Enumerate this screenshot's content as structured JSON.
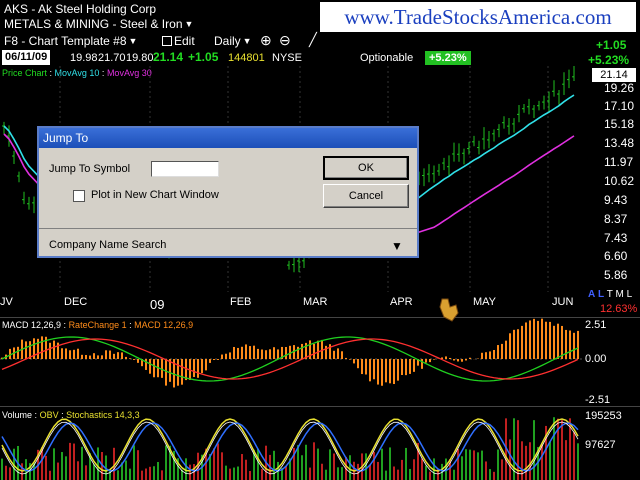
{
  "header": {
    "symbol_line": "AKS - Ak Steel Holding Corp",
    "sector": "METALS & MINING - Steel & Iron",
    "template": "F8 - Chart Template #8",
    "edit": "Edit",
    "period": "Daily"
  },
  "watermark": "www.TradeStocksAmerica.com",
  "quote": {
    "date": "06/11/09",
    "open": "19.98",
    "high": "21.70",
    "low": "19.80",
    "last": "21.14",
    "change": "+1.05",
    "volume": "144801",
    "exchange": "NYSE",
    "optionable": "Optionable",
    "pct": "+5.23%",
    "right_change": "+1.05",
    "right_pct": "+5.23%",
    "last_box": "21.14"
  },
  "price_panel": {
    "label_price": "Price Chart",
    "label_ma10": "MovAvg 10",
    "label_ma30": "MovAvg 30",
    "y_labels": [
      "19.26",
      "17.10",
      "15.18",
      "13.48",
      "11.97",
      "10.62",
      "9.43",
      "8.37",
      "7.43",
      "6.60",
      "5.86"
    ],
    "x_labels": [
      "JV",
      "DEC",
      "09",
      "FEB",
      "MAR",
      "APR",
      "MAY",
      "JUN"
    ],
    "period_buttons": [
      "A",
      "L",
      "T",
      "M",
      "L"
    ],
    "bottom_pct": "12.63%"
  },
  "macd_panel": {
    "label_macd": "MACD 12,26,9",
    "label_rate": "RateChange 1",
    "label_macd2": "MACD 12,26,9",
    "y_labels": [
      "2.51",
      "0.00",
      "-2.51"
    ]
  },
  "volume_panel": {
    "label_volume": "Volume",
    "label_obv": "OBV",
    "label_stoch": "Stochastics 14,3,3",
    "y_labels": [
      "195253",
      "97627"
    ]
  },
  "dialog": {
    "title": "Jump To",
    "symbol_label": "Jump To Symbol",
    "symbol_value": "",
    "plot_new_label": "Plot in New Chart Window",
    "ok": "OK",
    "cancel": "Cancel",
    "company_search": "Company Name Search"
  },
  "colors": {
    "ma10": "#30e0e8",
    "ma30": "#e030e0",
    "candle": "#20c020",
    "macd_hist": "#ff8c1a",
    "badge": "#22c022"
  }
}
